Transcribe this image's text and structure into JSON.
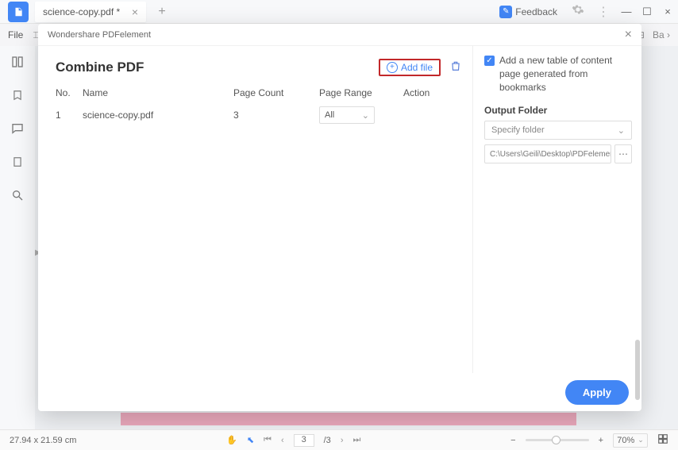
{
  "titlebar": {
    "tab_name": "science-copy.pdf *",
    "feedback_label": "Feedback"
  },
  "menubar": {
    "file_label": "File",
    "right_label": "Ba"
  },
  "modal": {
    "app_title": "Wondershare PDFelement",
    "heading": "Combine PDF",
    "add_file_label": "Add file",
    "columns": {
      "no": "No.",
      "name": "Name",
      "page_count": "Page Count",
      "page_range": "Page Range",
      "action": "Action"
    },
    "rows": [
      {
        "no": "1",
        "name": "science-copy.pdf",
        "page_count": "3",
        "page_range": "All"
      }
    ],
    "right": {
      "toc_checkbox_label": "Add a new table of content page generated from bookmarks",
      "output_folder_label": "Output Folder",
      "specify_folder_placeholder": "Specify folder",
      "folder_path": "C:\\Users\\Geili\\Desktop\\PDFelement\\Cc"
    },
    "apply_label": "Apply"
  },
  "statusbar": {
    "dimensions": "27.94 x 21.59 cm",
    "page_current": "3",
    "page_total": "/3",
    "zoom_label": "70%"
  }
}
